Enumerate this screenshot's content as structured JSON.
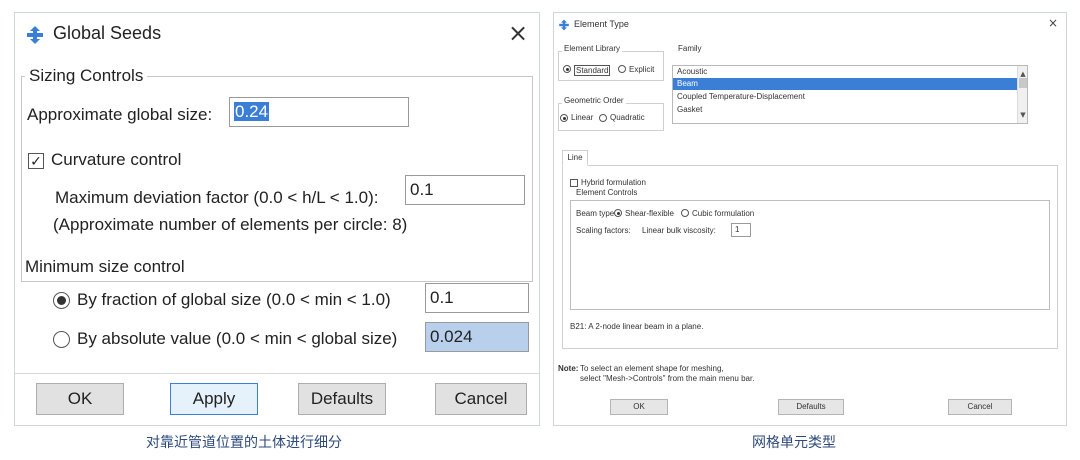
{
  "global_seeds": {
    "title": "Global Seeds",
    "close_glyph": "×",
    "sizing_controls": {
      "legend": "Sizing Controls",
      "approx_size_label": "Approximate global size:",
      "approx_size_value": "0.24",
      "curvature_label": "Curvature control",
      "curvature_checked": true,
      "check_glyph": "✓",
      "max_dev_label": "Maximum deviation factor (0.0 < h/L < 1.0):",
      "max_dev_value": "0.1",
      "approx_elements_note": "(Approximate number of elements per circle: 8)"
    },
    "min_size": {
      "label": "Minimum size control",
      "fraction_label": "By fraction of global size   (0.0 < min < 1.0)",
      "fraction_value": "0.1",
      "fraction_selected": true,
      "absolute_label": "By absolute value  (0.0 < min < global size)",
      "absolute_value": "0.024",
      "absolute_selected": false
    },
    "buttons": {
      "ok": "OK",
      "apply": "Apply",
      "defaults": "Defaults",
      "cancel": "Cancel"
    },
    "caption": "对靠近管道位置的土体进行细分"
  },
  "element_type": {
    "title": "Element Type",
    "close_glyph": "×",
    "element_library": {
      "legend": "Element Library",
      "standard": "Standard",
      "explicit": "Explicit",
      "selected": "Standard"
    },
    "family": {
      "legend": "Family",
      "items": [
        "Acoustic",
        "Beam",
        "Coupled Temperature-Displacement",
        "Gasket"
      ],
      "selected": "Beam",
      "scroll_up": "▲",
      "scroll_down": "▼"
    },
    "geometric_order": {
      "legend": "Geometric Order",
      "linear": "Linear",
      "quadratic": "Quadratic",
      "selected": "Linear"
    },
    "tab_line": "Line",
    "hybrid_label": "Hybrid formulation",
    "element_controls": {
      "legend": "Element Controls",
      "beam_type_label": "Beam type:",
      "shear_flexible": "Shear-flexible",
      "cubic": "Cubic formulation",
      "scaling_label": "Scaling factors:",
      "linear_bulk_label": "Linear bulk viscosity:",
      "linear_bulk_value": "1"
    },
    "description": "B21:  A 2-node linear beam in a plane.",
    "note_bold": "Note:",
    "note_line1": "To select an element shape for meshing,",
    "note_line2": "select \"Mesh->Controls\" from the main menu bar.",
    "buttons": {
      "ok": "OK",
      "defaults": "Defaults",
      "cancel": "Cancel"
    },
    "caption": "网格单元类型"
  },
  "colors": {
    "accent_blue": "#3b7ed6",
    "filled_field": "#b9d0ec",
    "caption_text": "#2c4a7c"
  }
}
